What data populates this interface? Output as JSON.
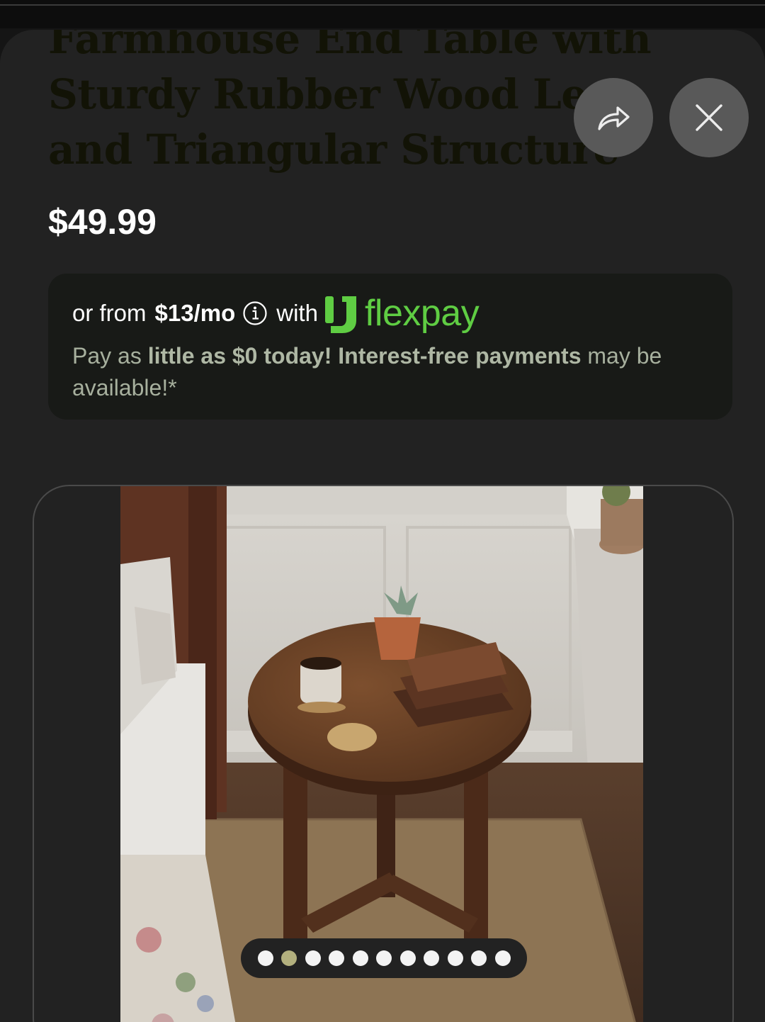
{
  "product": {
    "title": "Farmhouse End Table with Sturdy Rubber Wood Legs and Triangular Structure",
    "price": "$49.99"
  },
  "actions": {
    "share_icon": "share-arrow-icon",
    "close_icon": "close-x-icon"
  },
  "financing": {
    "prefix": "or from",
    "amount": "$13/mo",
    "with_label": "with",
    "brand": "flexpay",
    "desc_pay_as": "Pay as",
    "desc_little": "little as $0 today! Interest-free payments",
    "desc_tail": "may be available!*",
    "colors": {
      "brand_green": "#5fcd43",
      "card_bg": "#181a17"
    }
  },
  "gallery": {
    "image_count": 11,
    "active_index": 1
  }
}
